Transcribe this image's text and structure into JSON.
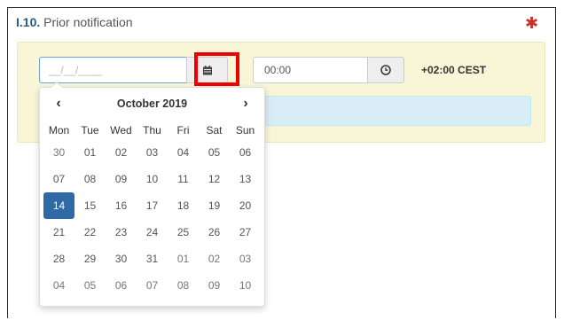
{
  "section": {
    "number": "I.10.",
    "title": "Prior notification",
    "required_marker": "✱"
  },
  "date_field": {
    "value": "",
    "placeholder": "__/__/____"
  },
  "time_field": {
    "value": "00:00"
  },
  "timezone": "+02:00 CEST",
  "datepicker": {
    "month_label": "October 2019",
    "prev": "‹",
    "next": "›",
    "weekdays": [
      "Mon",
      "Tue",
      "Wed",
      "Thu",
      "Fri",
      "Sat",
      "Sun"
    ],
    "weeks": [
      [
        "30",
        "01",
        "02",
        "03",
        "04",
        "05",
        "06"
      ],
      [
        "07",
        "08",
        "09",
        "10",
        "11",
        "12",
        "13"
      ],
      [
        "14",
        "15",
        "16",
        "17",
        "18",
        "19",
        "20"
      ],
      [
        "21",
        "22",
        "23",
        "24",
        "25",
        "26",
        "27"
      ],
      [
        "28",
        "29",
        "30",
        "31",
        "01",
        "02",
        "03"
      ],
      [
        "04",
        "05",
        "06",
        "07",
        "08",
        "09",
        "10"
      ]
    ],
    "selected_day": "14",
    "other_month_cells": [
      [
        0,
        0
      ],
      [
        4,
        4
      ],
      [
        4,
        5
      ],
      [
        4,
        6
      ],
      [
        5,
        0
      ],
      [
        5,
        1
      ],
      [
        5,
        2
      ],
      [
        5,
        3
      ],
      [
        5,
        4
      ],
      [
        5,
        5
      ],
      [
        5,
        6
      ]
    ]
  },
  "icons": {
    "calendar_button": "calendar-icon",
    "time_button": "clock-icon"
  },
  "colors": {
    "section_number": "#2c5a86",
    "required": "#c9302c",
    "panel_bg": "#f9f6d7",
    "info_bg": "#d9edf7",
    "selected_day_bg": "#2f6aa6",
    "highlight_box": "#ee0000"
  }
}
